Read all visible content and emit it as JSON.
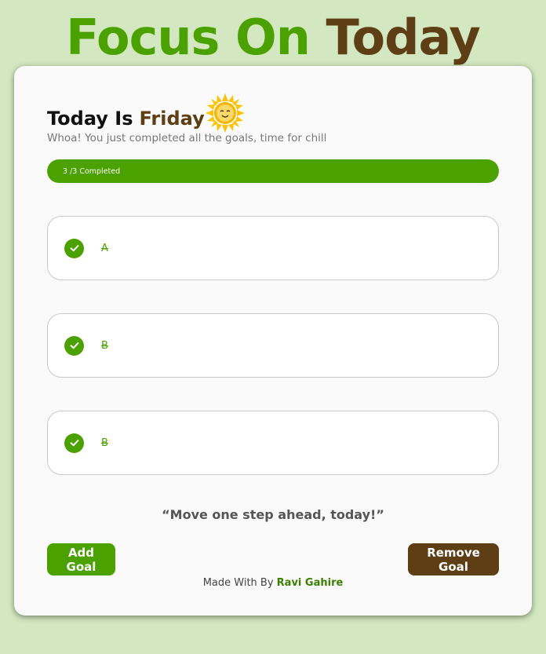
{
  "app": {
    "title_part1": "Focus On",
    "title_part2": "Today"
  },
  "header": {
    "prefix": "Today Is",
    "day": "Friday",
    "subtitle": "Whoa! You just completed all the goals, time for chill"
  },
  "progress": {
    "label": "3 /3 Completed",
    "completed": 3,
    "total": 3
  },
  "goals": [
    {
      "text": "A",
      "completed": true
    },
    {
      "text": "B",
      "completed": true
    },
    {
      "text": "B",
      "completed": true
    }
  ],
  "quote": "“Move one step ahead, today!”",
  "buttons": {
    "add": "Add Goal",
    "remove": "Remove Goal"
  },
  "footer": {
    "prefix": "Made With By",
    "author": "Ravi Gahire"
  },
  "colors": {
    "accent_green": "#4aa100",
    "accent_brown": "#5e3f15",
    "background": "#d3e8c0"
  },
  "icons": [
    "sun-icon",
    "check-icon"
  ]
}
